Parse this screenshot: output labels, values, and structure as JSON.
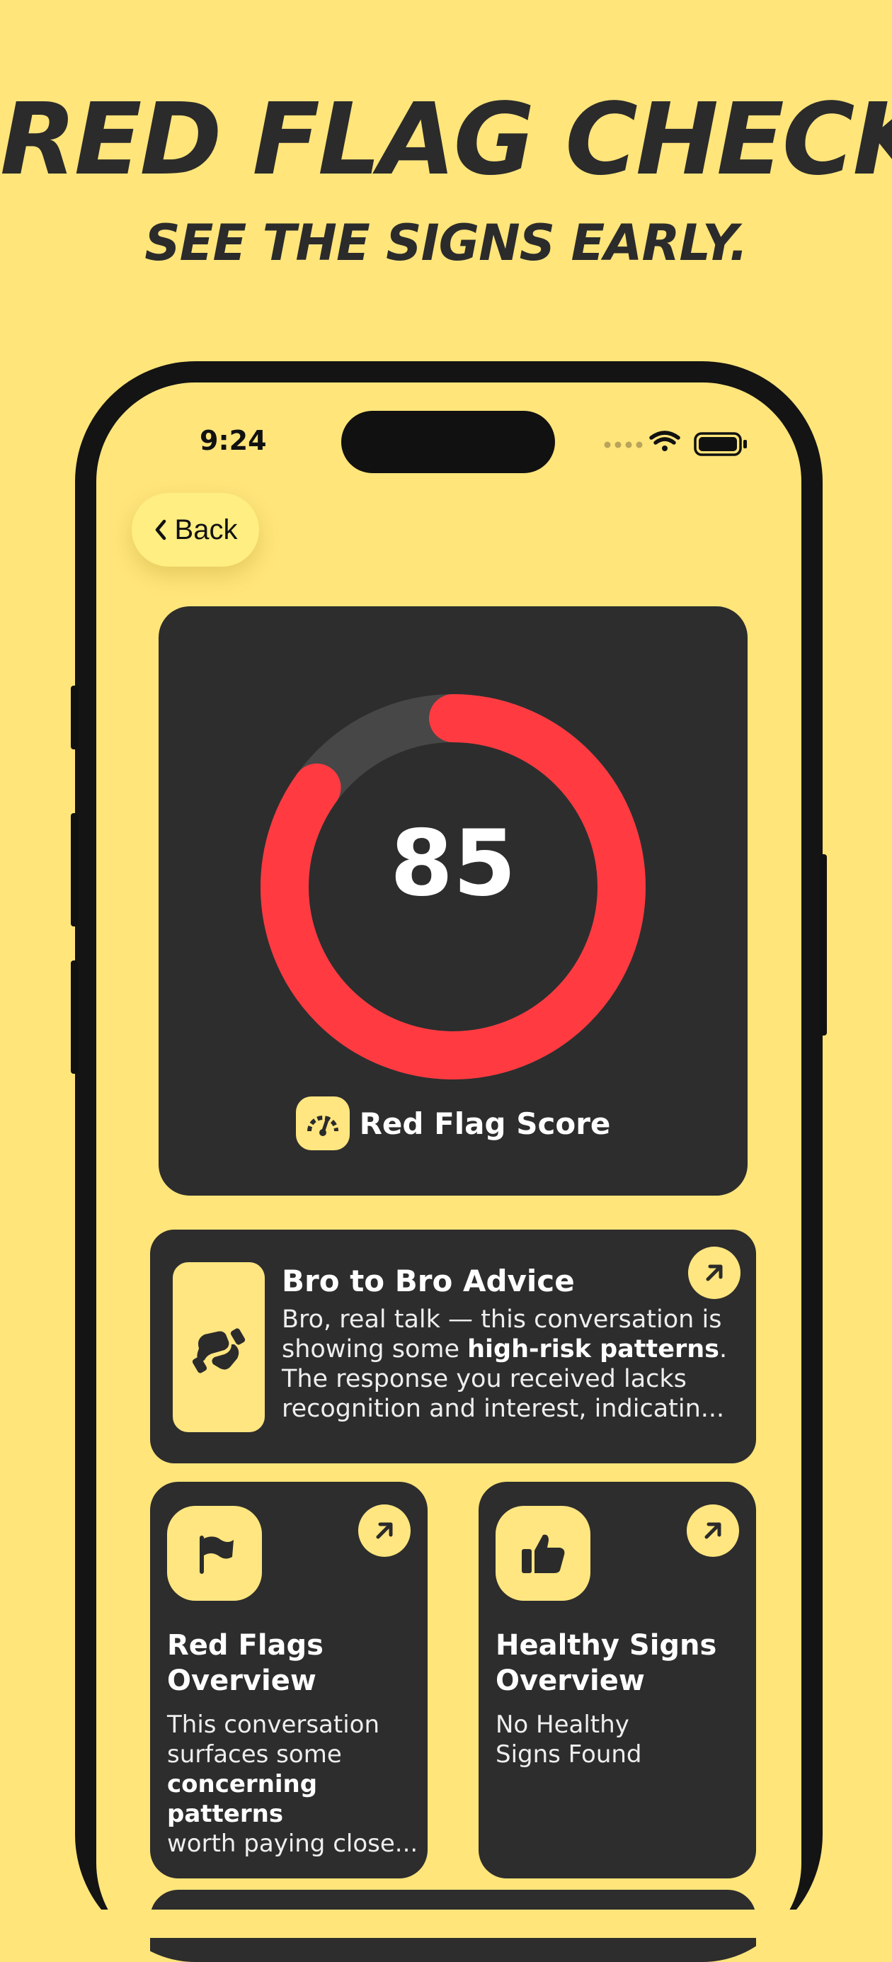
{
  "hero": {
    "title": "RED FLAG CHECK",
    "subtitle": "SEE THE SIGNS EARLY."
  },
  "status_bar": {
    "time": "9:24",
    "icons": [
      "signal-dots-icon",
      "wifi-icon",
      "battery-icon"
    ]
  },
  "nav": {
    "back_label": "Back",
    "back_icon": "chevron-left-icon"
  },
  "score": {
    "value": "85",
    "fraction": 0.85,
    "label": "Red Flag Score",
    "icon": "gauge-icon",
    "ring_color": "#FF3B41",
    "track_color": "#474747"
  },
  "advice": {
    "title": "Bro to Bro Advice",
    "line1": "Bro, real talk — this conversation is",
    "line2_prefix": "showing some ",
    "line2_bold": "high-risk patterns",
    "line2_suffix": ".",
    "line3": "The response you received lacks",
    "line4": "recognition and interest, indicatin...",
    "icon": "handshake-icon",
    "link_icon": "arrow-up-right-icon"
  },
  "red_flags": {
    "title_line1": "Red Flags",
    "title_line2": "Overview",
    "line1": "This conversation",
    "line2": "surfaces some",
    "line3": "concerning patterns",
    "line4": "worth paying close...",
    "icon": "flag-icon",
    "link_icon": "arrow-up-right-icon"
  },
  "healthy_signs": {
    "title_line1": "Healthy Signs",
    "title_line2": "Overview",
    "line1": "No Healthy",
    "line2": "Signs Found",
    "icon": "thumbs-up-icon",
    "link_icon": "arrow-up-right-icon"
  },
  "colors": {
    "background": "#FFE57A",
    "card": "#2D2D2D",
    "accent_yellow": "#FFE680",
    "danger_red": "#FF3B41",
    "text_dark": "#2B2B2B"
  }
}
